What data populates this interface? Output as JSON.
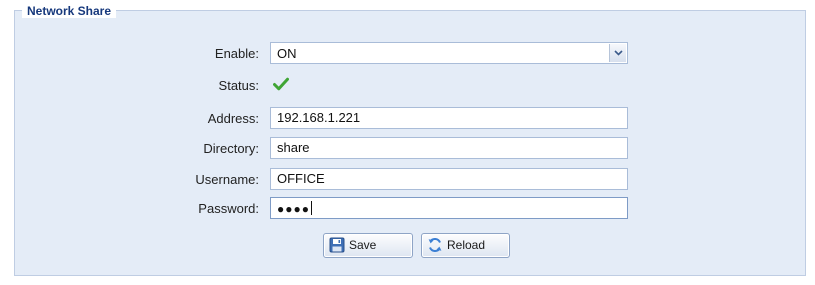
{
  "panel": {
    "title": "Network Share"
  },
  "form": {
    "enable": {
      "label": "Enable:",
      "value": "ON"
    },
    "status": {
      "label": "Status:",
      "icon": "check-icon",
      "icon_color": "#3fa535"
    },
    "address": {
      "label": "Address:",
      "value": "192.168.1.221"
    },
    "directory": {
      "label": "Directory:",
      "value": "share"
    },
    "username": {
      "label": "Username:",
      "value": "OFFICE"
    },
    "password": {
      "label": "Password:",
      "value": "●●●●"
    }
  },
  "buttons": {
    "save_label": "Save",
    "save_icon": "floppy-disk-icon",
    "reload_label": "Reload",
    "reload_icon": "refresh-icon"
  },
  "colors": {
    "panel_background": "#e4ecf7",
    "title_color": "#16387c"
  }
}
